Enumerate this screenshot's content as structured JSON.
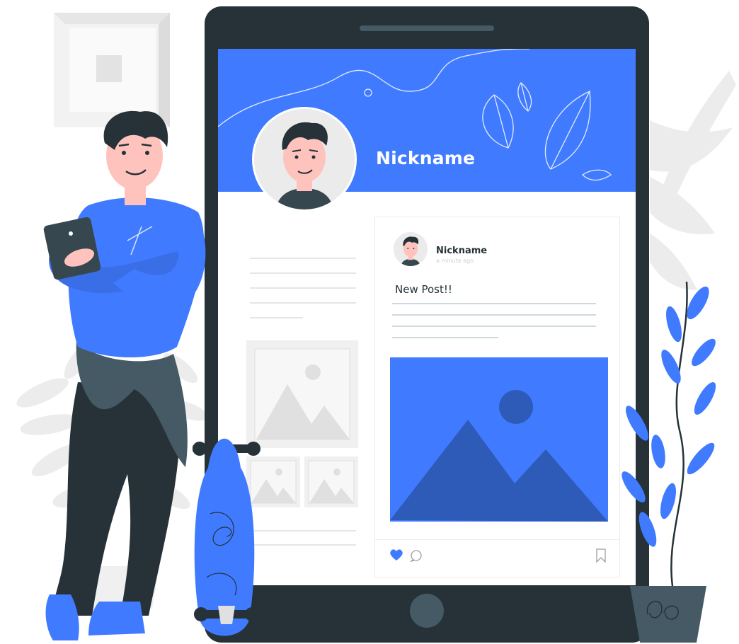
{
  "profile": {
    "nickname": "Nickname"
  },
  "post": {
    "author": "Nickname",
    "time": "a minute ago",
    "text": "New Post!!"
  },
  "icons": {
    "like": "heart-icon",
    "comment": "comment-icon",
    "bookmark": "bookmark-icon",
    "image": "image-placeholder-icon"
  },
  "colors": {
    "accent": "#407bff",
    "dark": "#263238",
    "skin": "#ffc3bd",
    "light_gray": "#ebebeb"
  }
}
